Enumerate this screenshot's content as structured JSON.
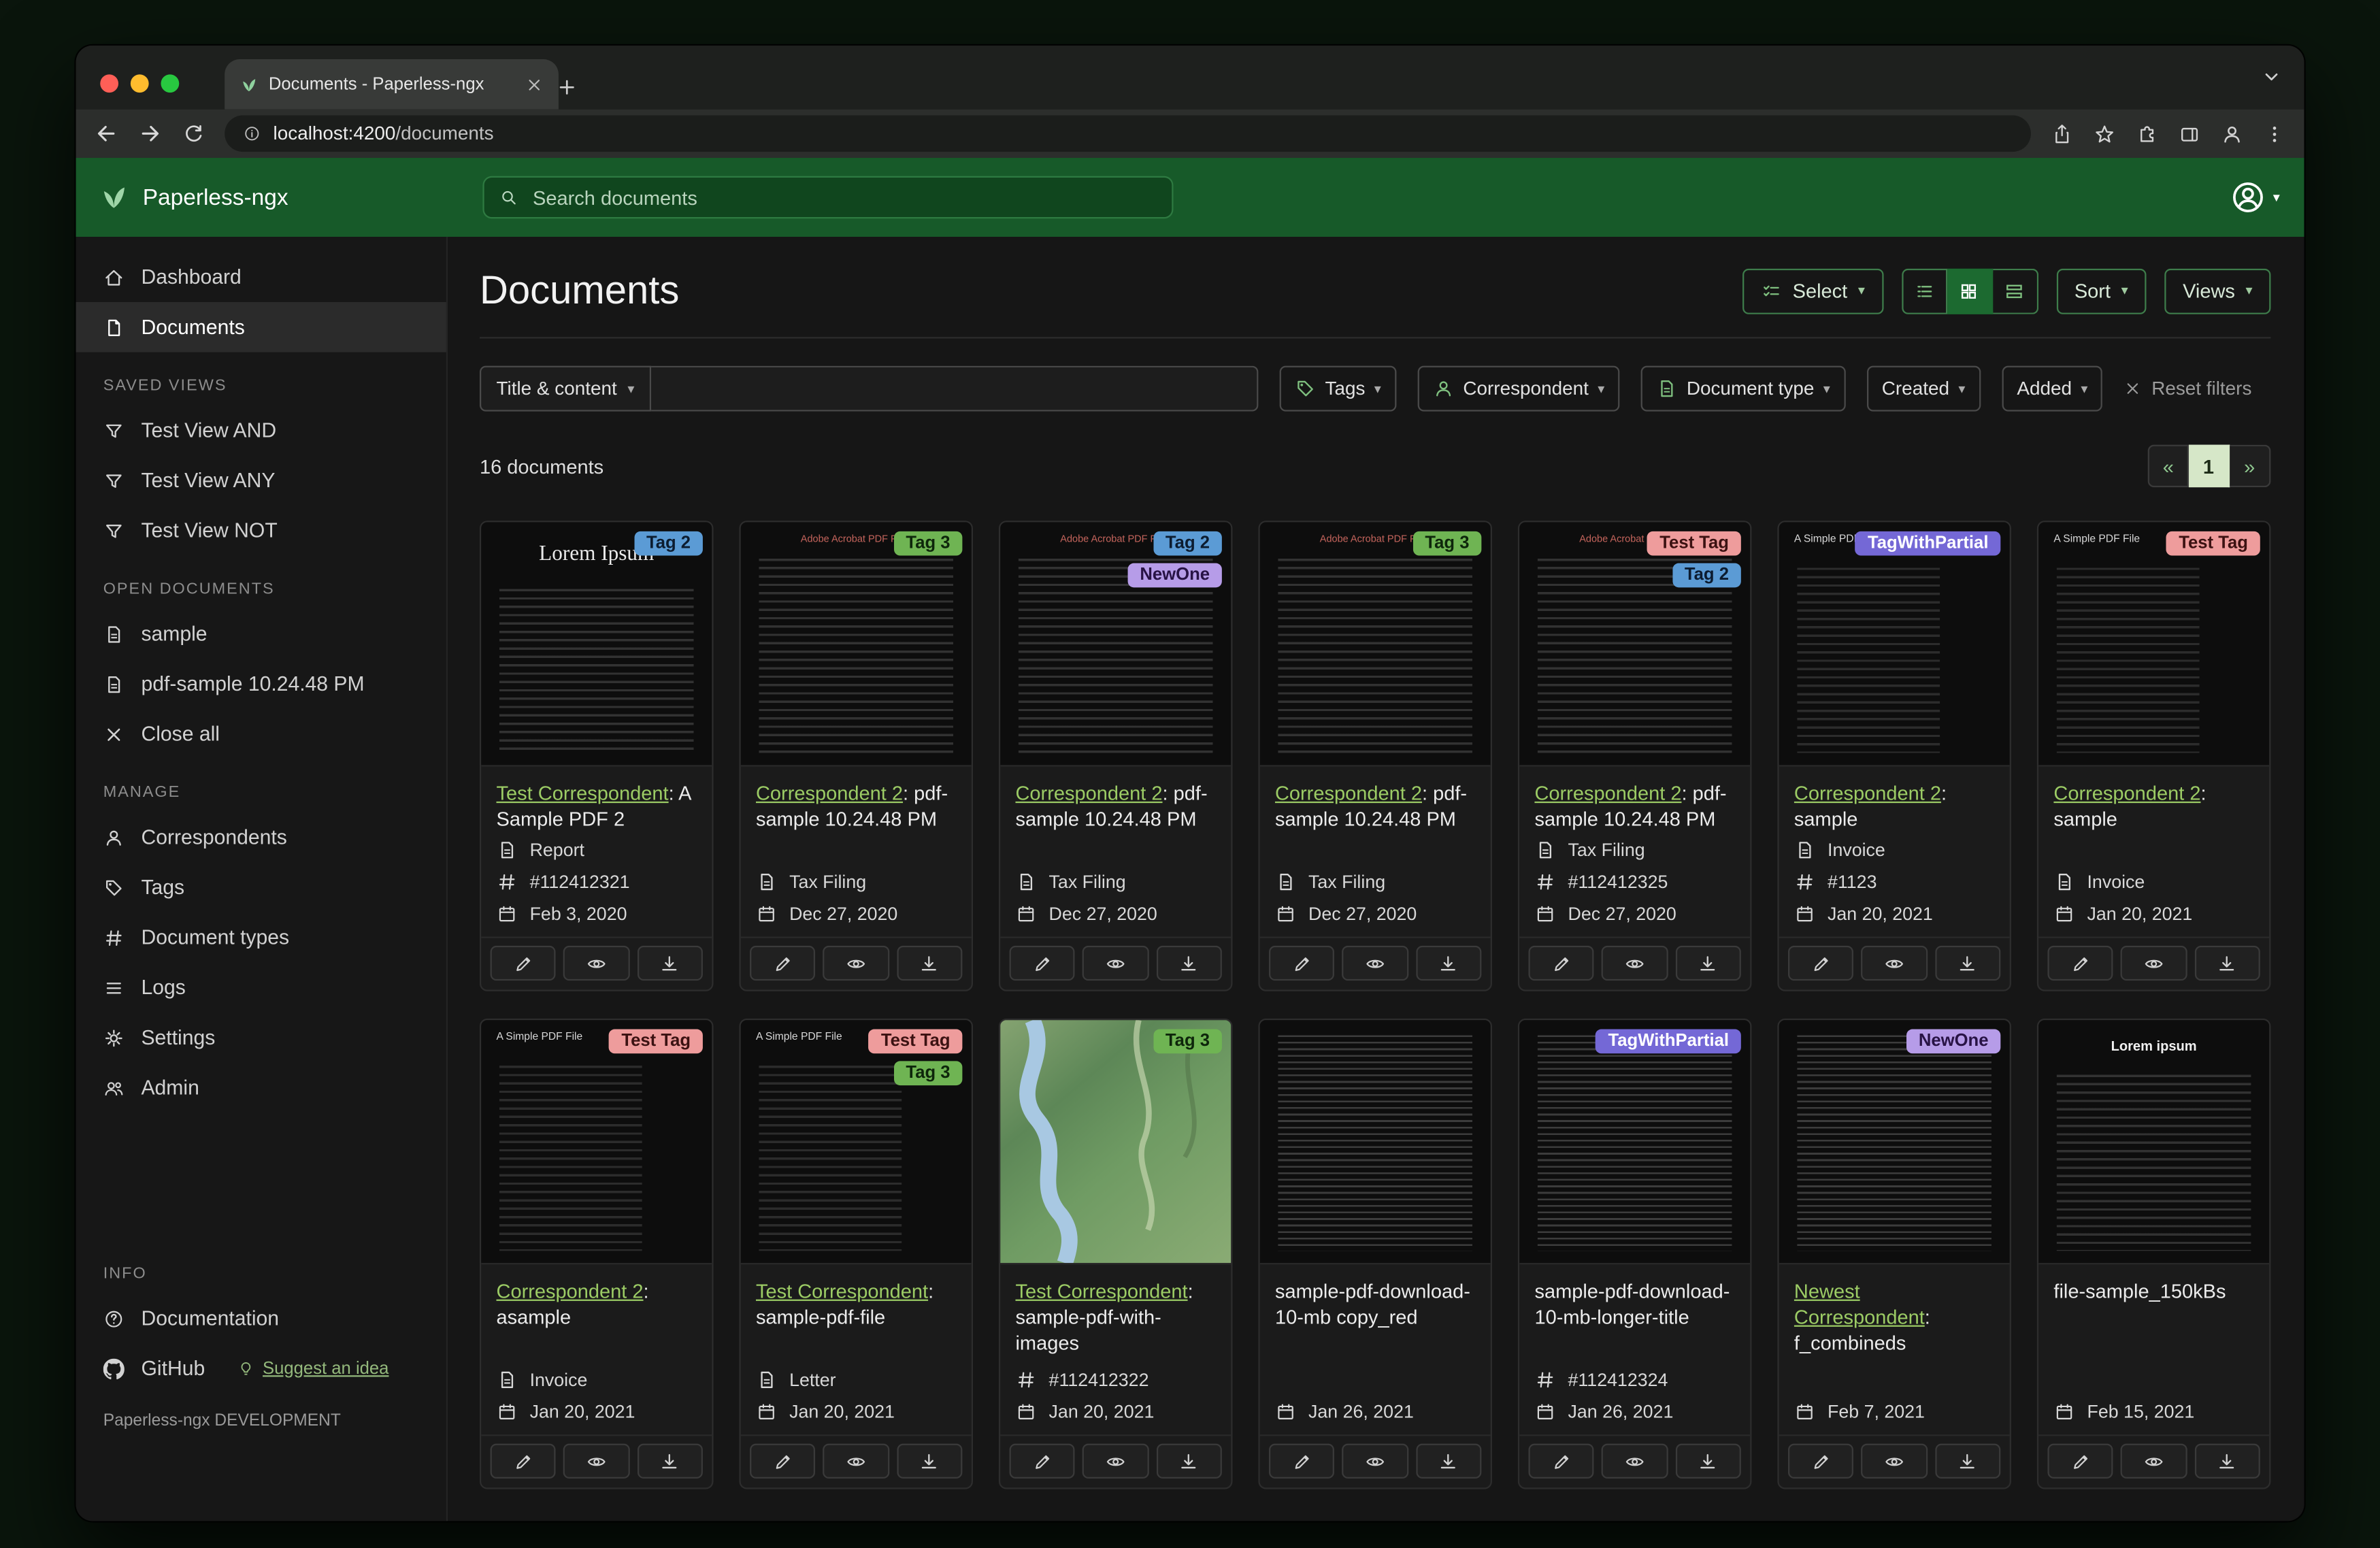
{
  "browser": {
    "tab_title": "Documents - Paperless-ngx",
    "url_host": "localhost:4200",
    "url_path": "/documents"
  },
  "header": {
    "brand": "Paperless-ngx",
    "search_placeholder": "Search documents"
  },
  "sidebar": {
    "nav": [
      {
        "label": "Dashboard"
      },
      {
        "label": "Documents"
      }
    ],
    "saved_views": {
      "label": "SAVED VIEWS",
      "items": [
        "Test View AND",
        "Test View ANY",
        "Test View NOT"
      ]
    },
    "open_documents": {
      "label": "OPEN DOCUMENTS",
      "items": [
        "sample",
        "pdf-sample 10.24.48 PM"
      ],
      "close_all": "Close all"
    },
    "manage": {
      "label": "MANAGE",
      "items": [
        "Correspondents",
        "Tags",
        "Document types",
        "Logs",
        "Settings",
        "Admin"
      ]
    },
    "info": {
      "label": "INFO",
      "items": [
        "Documentation",
        "GitHub"
      ],
      "suggest": "Suggest an idea"
    },
    "footer": "Paperless-ngx DEVELOPMENT"
  },
  "toolbar": {
    "title": "Documents",
    "select": "Select",
    "sort": "Sort",
    "views": "Views"
  },
  "filters": {
    "title_content": "Title & content",
    "tags": "Tags",
    "correspondent": "Correspondent",
    "document_type": "Document type",
    "created": "Created",
    "added": "Added",
    "reset": "Reset filters"
  },
  "results": {
    "count": "16 documents",
    "pagination": {
      "prev": "«",
      "page": "1",
      "next": "»"
    }
  },
  "accent": {
    "link_green": "#9ccc65",
    "header_green": "#175a29"
  },
  "cards": [
    {
      "tags": [
        {
          "label": "Tag 2",
          "bg": "#5b9bd5",
          "fg": "#0c1c30"
        }
      ],
      "link": "Test Correspondent",
      "rest": ": A Sample PDF 2",
      "type": "Report",
      "asn": "#112412321",
      "date": "Feb 3, 2020",
      "thumb": {
        "kind": "lorem",
        "title": "Lorem Ipsum"
      }
    },
    {
      "tags": [
        {
          "label": "Tag 3",
          "bg": "#6fb453",
          "fg": "#0e260b"
        }
      ],
      "link": "Correspondent 2",
      "rest": ": pdf-sample 10.24.48 PM",
      "type": "Tax Filing",
      "date": "Dec 27, 2020",
      "thumb": {
        "kind": "adobe",
        "title": "Adobe Acrobat PDF Files"
      }
    },
    {
      "tags": [
        {
          "label": "Tag 2",
          "bg": "#5b9bd5",
          "fg": "#0c1c30"
        },
        {
          "label": "NewOne",
          "bg": "#b69ce8",
          "fg": "#281345"
        }
      ],
      "link": "Correspondent 2",
      "rest": ": pdf-sample 10.24.48 PM",
      "type": "Tax Filing",
      "date": "Dec 27, 2020",
      "thumb": {
        "kind": "adobe",
        "title": "Adobe Acrobat PDF Files"
      }
    },
    {
      "tags": [
        {
          "label": "Tag 3",
          "bg": "#6fb453",
          "fg": "#0e260b"
        }
      ],
      "link": "Correspondent 2",
      "rest": ": pdf-sample 10.24.48 PM",
      "type": "Tax Filing",
      "date": "Dec 27, 2020",
      "thumb": {
        "kind": "adobe",
        "title": "Adobe Acrobat PDF Files"
      }
    },
    {
      "tags": [
        {
          "label": "Test Tag",
          "bg": "#ee9c9c",
          "fg": "#3c1212"
        },
        {
          "label": "Tag 2",
          "bg": "#5b9bd5",
          "fg": "#0c1c30"
        }
      ],
      "link": "Correspondent 2",
      "rest": ": pdf-sample 10.24.48 PM",
      "type": "Tax Filing",
      "asn": "#112412325",
      "date": "Dec 27, 2020",
      "thumb": {
        "kind": "adobe",
        "title": "Adobe Acrobat PDF Files"
      }
    },
    {
      "tags": [
        {
          "label": "TagWithPartial",
          "bg": "#7468d6",
          "fg": "#ffffff"
        }
      ],
      "link": "Correspondent 2",
      "rest": ": sample",
      "type": "Invoice",
      "asn": "#1123",
      "date": "Jan 20, 2021",
      "thumb": {
        "kind": "simple",
        "title": "A Simple PDF File"
      }
    },
    {
      "tags": [
        {
          "label": "Test Tag",
          "bg": "#ee9c9c",
          "fg": "#3c1212"
        }
      ],
      "link": "Correspondent 2",
      "rest": ": sample",
      "type": "Invoice",
      "date": "Jan 20, 2021",
      "thumb": {
        "kind": "simple",
        "title": "A Simple PDF File"
      }
    },
    {
      "tags": [
        {
          "label": "Test Tag",
          "bg": "#ee9c9c",
          "fg": "#3c1212"
        }
      ],
      "link": "Correspondent 2",
      "rest": ": asample",
      "type": "Invoice",
      "date": "Jan 20, 2021",
      "thumb": {
        "kind": "simple",
        "title": "A Simple PDF File"
      }
    },
    {
      "tags": [
        {
          "label": "Test Tag",
          "bg": "#ee9c9c",
          "fg": "#3c1212"
        },
        {
          "label": "Tag 3",
          "bg": "#6fb453",
          "fg": "#0e260b"
        }
      ],
      "link": "Test Correspondent",
      "rest": ": sample-pdf-file",
      "type": "Letter",
      "date": "Jan 20, 2021",
      "thumb": {
        "kind": "simple",
        "title": "A Simple PDF File"
      }
    },
    {
      "tags": [
        {
          "label": "Tag 3",
          "bg": "#6fb453",
          "fg": "#0e260b"
        }
      ],
      "link": "Test Correspondent",
      "rest": ": sample-pdf-with-images",
      "asn": "#112412322",
      "date": "Jan 20, 2021",
      "thumb": {
        "kind": "map"
      }
    },
    {
      "tags": [],
      "rest": "sample-pdf-download-10-mb copy_red",
      "date": "Jan 26, 2021",
      "thumb": {
        "kind": "dense"
      }
    },
    {
      "tags": [
        {
          "label": "TagWithPartial",
          "bg": "#7468d6",
          "fg": "#ffffff"
        }
      ],
      "rest": "sample-pdf-download-10-mb-longer-title",
      "asn": "#112412324",
      "date": "Jan 26, 2021",
      "thumb": {
        "kind": "dense"
      }
    },
    {
      "tags": [
        {
          "label": "NewOne",
          "bg": "#b69ce8",
          "fg": "#281345"
        }
      ],
      "link": "Newest Correspondent",
      "rest": ": f_combineds",
      "date": "Feb 7, 2021",
      "thumb": {
        "kind": "dense"
      }
    },
    {
      "tags": [],
      "rest": "file-sample_150kBs",
      "date": "Feb 15, 2021",
      "thumb": {
        "kind": "lorem2",
        "title": "Lorem ipsum"
      }
    }
  ]
}
